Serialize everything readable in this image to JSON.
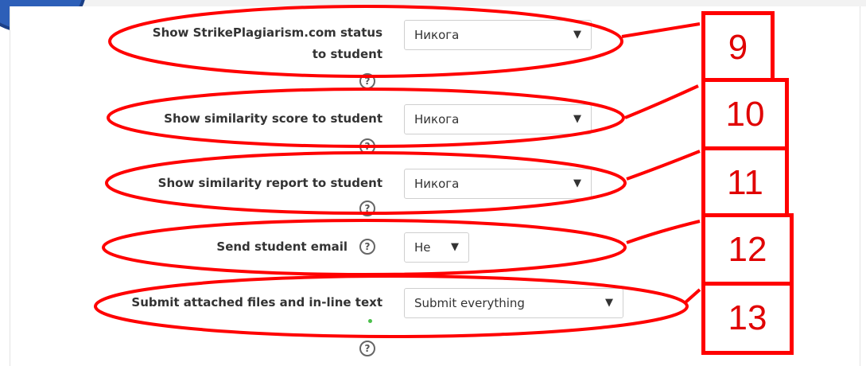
{
  "rows": [
    {
      "label_line1": "Show StrikePlagiarism.com status",
      "label_line2": "to student",
      "value": "Никога",
      "number": "9"
    },
    {
      "label": "Show similarity score to student",
      "value": "Никога",
      "number": "10"
    },
    {
      "label": "Show similarity report to student",
      "value": "Никога",
      "number": "11"
    },
    {
      "label": "Send student email",
      "value": "Не",
      "number": "12"
    },
    {
      "label": "Submit attached files and in-line text",
      "value": "Submit everything",
      "number": "13"
    }
  ],
  "help_glyph": "?",
  "arrow_glyph": "▼",
  "annotation_color": "#ff0000"
}
